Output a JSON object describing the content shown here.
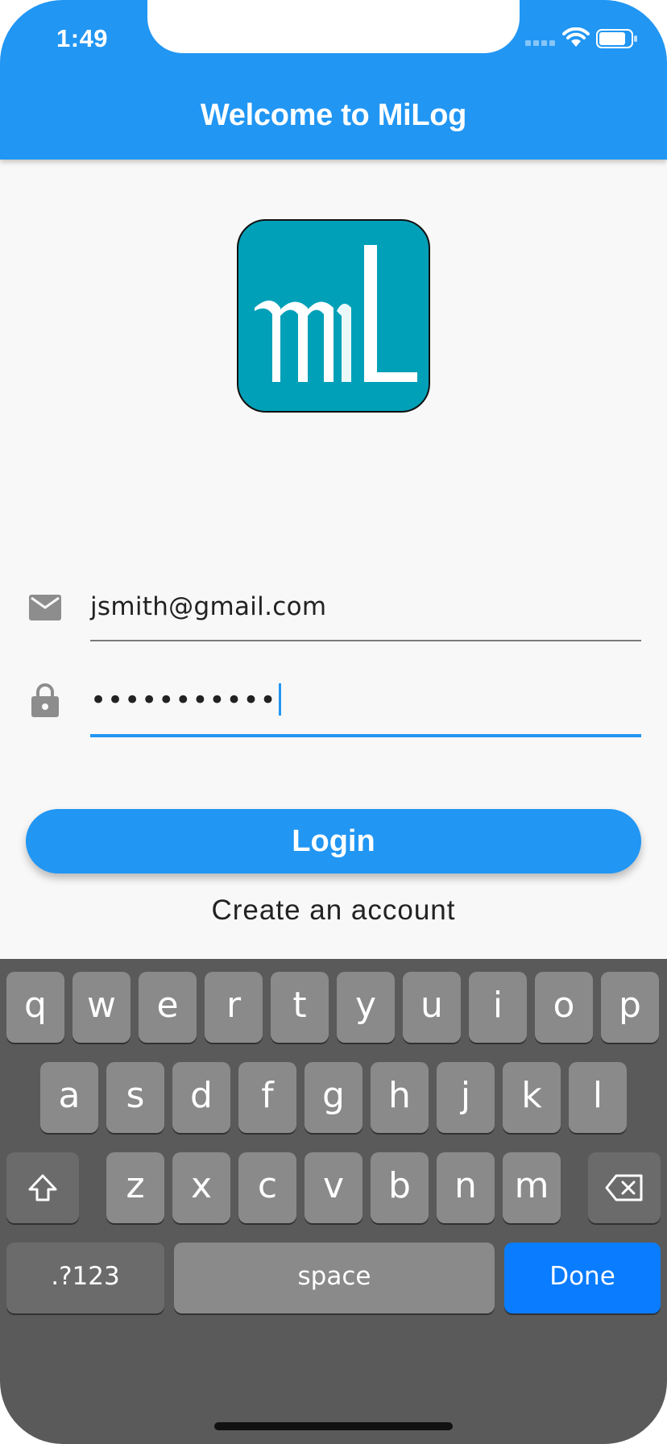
{
  "status_bar": {
    "time": "1:49"
  },
  "app_bar": {
    "title": "Welcome to MiLog"
  },
  "logo": {
    "alt": "mL"
  },
  "form": {
    "email": {
      "value": "jsmith@gmail.com",
      "icon": "envelope-icon"
    },
    "password": {
      "value": "•••••••••••",
      "icon": "lock-icon"
    }
  },
  "actions": {
    "login_label": "Login",
    "create_account_label": "Create an account"
  },
  "keyboard": {
    "row1": [
      "q",
      "w",
      "e",
      "r",
      "t",
      "y",
      "u",
      "i",
      "o",
      "p"
    ],
    "row2": [
      "a",
      "s",
      "d",
      "f",
      "g",
      "h",
      "j",
      "k",
      "l"
    ],
    "row3": [
      "z",
      "x",
      "c",
      "v",
      "b",
      "n",
      "m"
    ],
    "numbers_label": ".?123",
    "space_label": "space",
    "done_label": "Done"
  },
  "colors": {
    "primary": "#2196f3",
    "logo_bg": "#00a0b8",
    "keyboard_bg": "#5a5a5a",
    "done_key": "#0a7cff"
  }
}
